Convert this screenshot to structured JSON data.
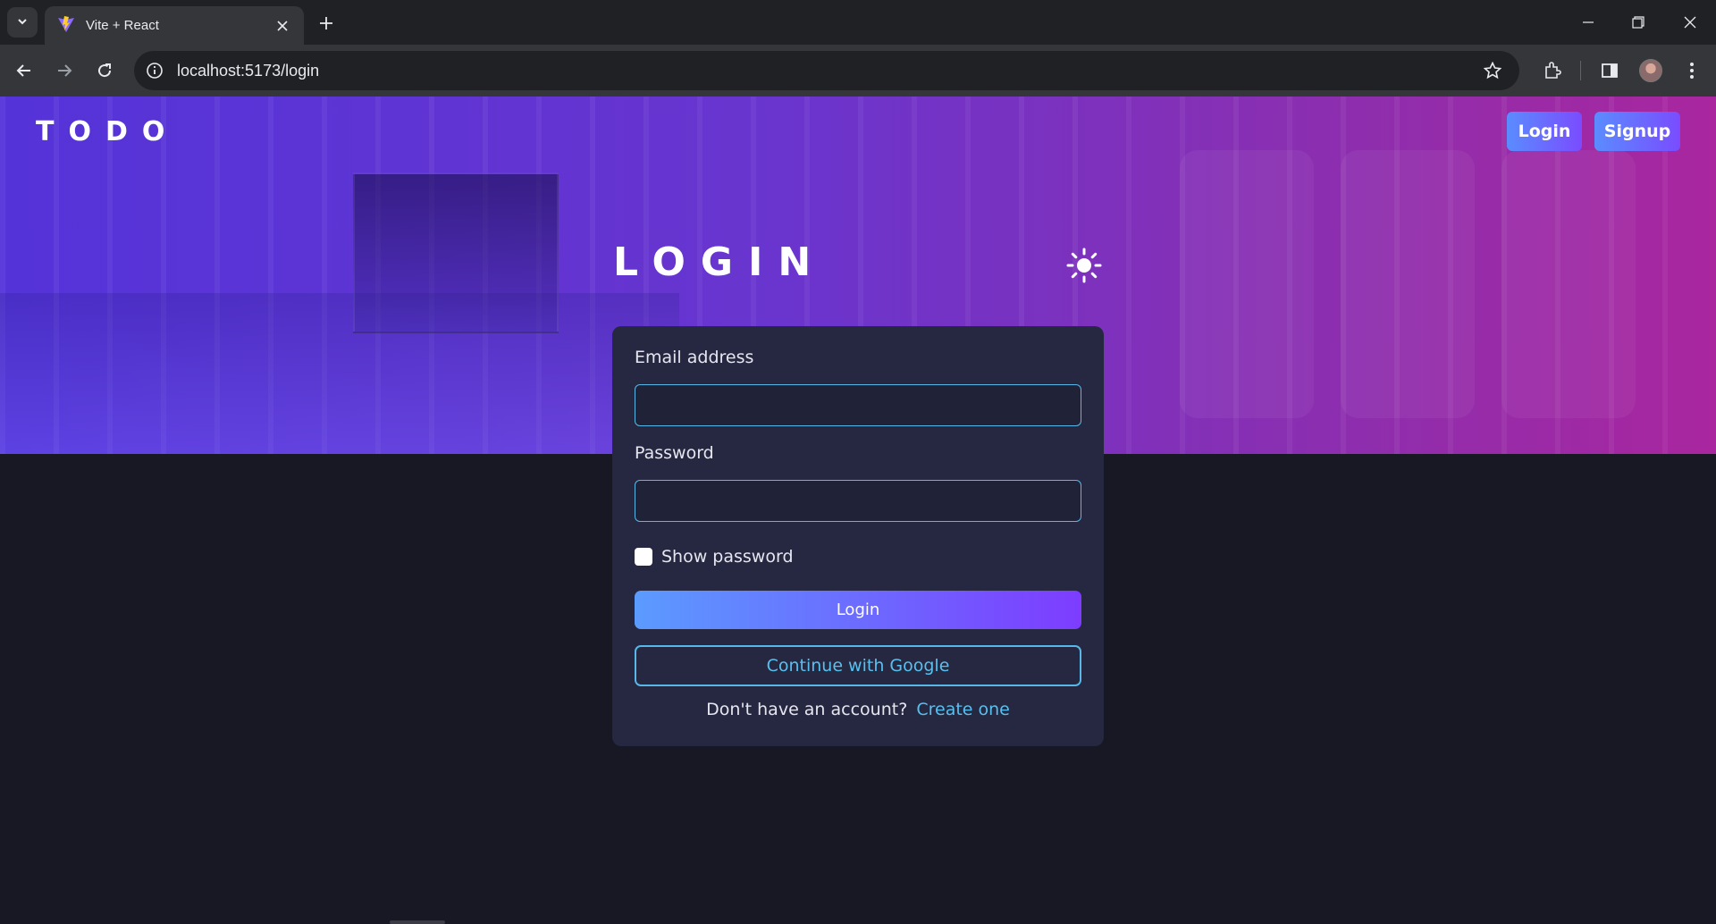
{
  "browser": {
    "tab_title": "Vite + React",
    "url": "localhost:5173/login"
  },
  "header": {
    "brand": "TODO",
    "login_label": "Login",
    "signup_label": "Signup"
  },
  "page": {
    "title": "LOGIN"
  },
  "form": {
    "email_label": "Email address",
    "email_value": "",
    "password_label": "Password",
    "password_value": "",
    "show_password_label": "Show password",
    "show_password_checked": false,
    "login_button": "Login",
    "google_button": "Continue with Google",
    "no_account_text": "Don't have an account?",
    "create_link": "Create one"
  },
  "colors": {
    "accent_cyan": "#57c0f0",
    "gradient_start": "#5b9bff",
    "gradient_end": "#7d3cff",
    "card_bg": "#252840",
    "page_bg": "#171823"
  }
}
